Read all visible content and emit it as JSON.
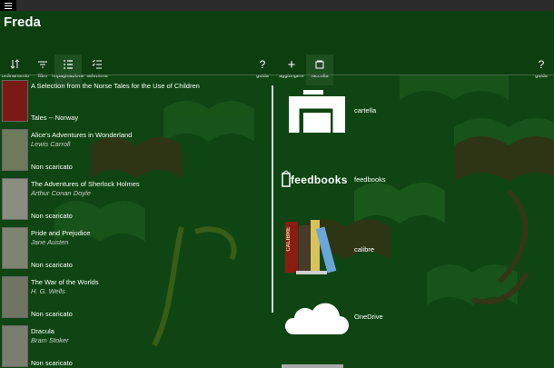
{
  "app": {
    "title": "Freda"
  },
  "toolbar_left": [
    {
      "label": "ordinamento",
      "icon": "sort-icon"
    },
    {
      "label": "filtro",
      "icon": "filter-icon"
    },
    {
      "label": "impaginazione",
      "icon": "list-layout-icon",
      "active": true
    },
    {
      "label": "seleziona",
      "icon": "multi-select-icon"
    }
  ],
  "toolbar_mid": [
    {
      "label": "guida",
      "icon": "help-icon"
    },
    {
      "label": "aggiungere",
      "icon": "add-icon"
    },
    {
      "label": "raccolta",
      "icon": "collection-icon",
      "active": true
    }
  ],
  "toolbar_right": [
    {
      "label": "guida",
      "icon": "help-icon"
    }
  ],
  "books": [
    {
      "title": "A Selection from the Norse Tales for the Use of Children",
      "author": "",
      "status": "Tales -- Norway",
      "cover_color": "#7a1a14"
    },
    {
      "title": "Alice's Adventures in Wonderland",
      "author": "Lewis Carroll",
      "status": "Non scaricato",
      "cover_color": "#6e7a5c"
    },
    {
      "title": "The Adventures of Sherlock Holmes",
      "author": "Arthur Conan Doyle",
      "status": "Non scaricato",
      "cover_color": "#8a8e80"
    },
    {
      "title": "Pride and Prejudice",
      "author": "Jane Austen",
      "status": "Non scaricato",
      "cover_color": "#7d8570"
    },
    {
      "title": "The War of the Worlds",
      "author": "H. G. Wells",
      "status": "Non scaricato",
      "cover_color": "#6f7560"
    },
    {
      "title": "Dracula",
      "author": "Bram Stoker",
      "status": "Non scaricato",
      "cover_color": "#7a7e6e"
    }
  ],
  "sources": [
    {
      "label": "cartella",
      "icon": "folder-icon"
    },
    {
      "label": "feedbooks",
      "icon": "feedbooks-logo",
      "logo_text": "feedbooks"
    },
    {
      "label": "calibre",
      "icon": "calibre-books-icon",
      "logo_text": "CALIBRE"
    },
    {
      "label": "OneDrive",
      "icon": "onedrive-cloud-icon"
    }
  ],
  "colors": {
    "background": "#0e4512",
    "appbar": "#0d3e10",
    "active": "#1e4f21",
    "accent_red": "#9a1a1a"
  }
}
